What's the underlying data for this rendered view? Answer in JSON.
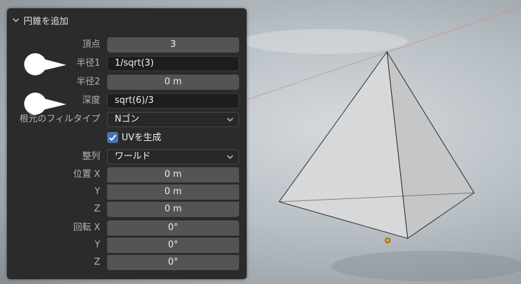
{
  "panel": {
    "title": "円錐を追加",
    "fields": {
      "vertices_label": "頂点",
      "vertices_value": "3",
      "radius1_label": "半径1",
      "radius1_value": "1/sqrt(3)",
      "radius2_label": "半径2",
      "radius2_value": "0 m",
      "depth_label": "深度",
      "depth_value": "sqrt(6)/3",
      "base_fill_label": "根元のフィルタイプ",
      "base_fill_value": "Nゴン",
      "uv_label": "UVを生成",
      "uv_checked": true,
      "align_label": "整列",
      "align_value": "ワールド",
      "location_x_label": "位置 X",
      "location_x": "0 m",
      "location_y_label": "Y",
      "location_y": "0 m",
      "location_z_label": "Z",
      "location_z": "0 m",
      "rotation_x_label": "回転 X",
      "rotation_x": "0°",
      "rotation_y_label": "Y",
      "rotation_y": "0°",
      "rotation_z_label": "Z",
      "rotation_z": "0°"
    }
  },
  "colors": {
    "panel_bg": "#2b2b2b",
    "field_bg": "#545454",
    "checkbox_accent": "#4772b3",
    "origin_dot": "#e8a020"
  }
}
